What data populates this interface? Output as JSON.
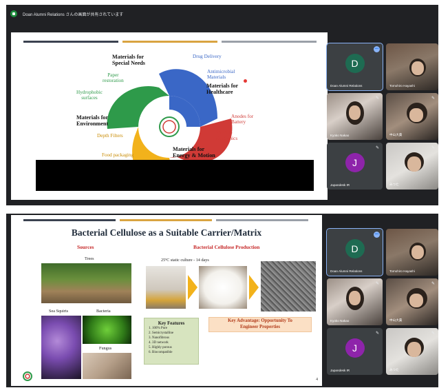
{
  "meeting": {
    "presenter_banner": "Doan Alumni Relations さんの画面が共有されています"
  },
  "slide1": {
    "center_labels": {
      "special": "Materials for\nSpecial Needs",
      "healthcare": "Materials for\nHealthcare",
      "environment": "Materials for\nEnvironment",
      "energy": "Materials for\nEnergy & Motion"
    },
    "items": {
      "paper": "Paper\nrestoration",
      "hydrophobic": "Hydrophobic\nsurfaces",
      "drug": "Drug Delivery",
      "antimicrobial": "Antimicrobial\nMaterials",
      "depth": "Depth Filters",
      "food": "Food packaging",
      "anodes": "Anodes for\nBattery",
      "flexible": "Flexible\nelectronics"
    },
    "colors": {
      "blue": "#3a67c6",
      "red": "#d03a36",
      "yellow": "#f2b21b",
      "green": "#2e9a4a"
    }
  },
  "slide2": {
    "title": "Bacterial Cellulose as a Suitable Carrier/Matrix",
    "sources_heading": "Sources",
    "production_heading": "Bacterial Cellulose Production",
    "trees_label": "Trees",
    "sea_squirts_label": "Sea Squirts",
    "bacteria_label": "Bacteria",
    "fungus_label": "Fungus",
    "culture_label": "25ºC static culture - 14 days",
    "key_features": {
      "title": "Key Features",
      "items": [
        "1. 100% Pure",
        "2. Semicrystalline",
        "3. Nanofibrous",
        "4. 3D network",
        "5. Highly porous",
        "6. Biocompatible"
      ]
    },
    "advantage": "Key Advantage: Opportunity To\nEngineer Properties",
    "page_number": "4"
  },
  "participants_top": [
    {
      "name": "Doan Alumni Relations",
      "initial": "D",
      "avatar_color": "#1e6b52"
    },
    {
      "name": "Tomohiro Hayashi"
    },
    {
      "name": "Kyoko Nakao"
    },
    {
      "name": "中山大貴"
    },
    {
      "name": "Japandesk IR",
      "initial": "J",
      "avatar_color": "#8e24aa"
    },
    {
      "name": "みつた"
    }
  ],
  "participants_bottom": [
    {
      "name": "Doan Alumni Relations",
      "initial": "D",
      "avatar_color": "#1e6b52"
    },
    {
      "name": "Tomohiro Hayashi"
    },
    {
      "name": "Kyoko Nakao"
    },
    {
      "name": "中山大貴"
    },
    {
      "name": "Japandesk IR",
      "initial": "J",
      "avatar_color": "#8e24aa"
    },
    {
      "name": "みつた"
    }
  ]
}
